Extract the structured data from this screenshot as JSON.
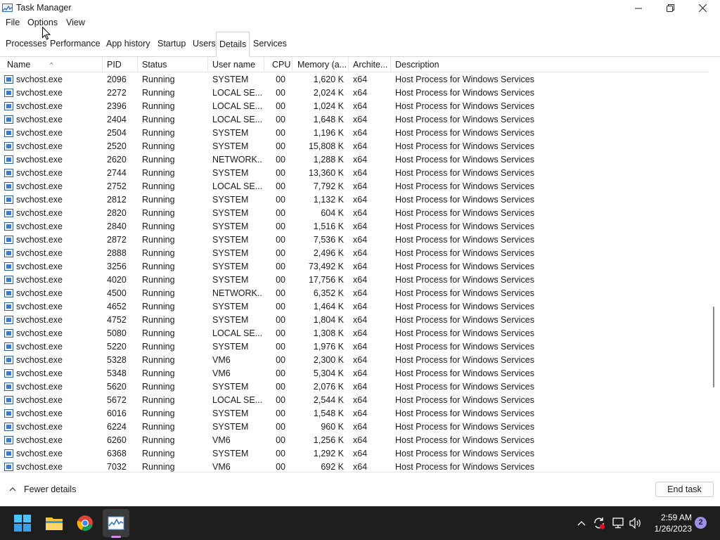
{
  "window": {
    "title": "Task Manager"
  },
  "menu": [
    "File",
    "Options",
    "View"
  ],
  "tabs": [
    {
      "label": "Processes",
      "active": false
    },
    {
      "label": "Performance",
      "active": false
    },
    {
      "label": "App history",
      "active": false
    },
    {
      "label": "Startup",
      "active": false
    },
    {
      "label": "Users",
      "active": false
    },
    {
      "label": "Details",
      "active": true
    },
    {
      "label": "Services",
      "active": false
    }
  ],
  "columns": {
    "name": "Name",
    "pid": "PID",
    "status": "Status",
    "user": "User name",
    "cpu": "CPU",
    "memory": "Memory (a...",
    "arch": "Archite...",
    "description": "Description"
  },
  "rows": [
    {
      "name": "svchost.exe",
      "pid": "2096",
      "status": "Running",
      "user": "SYSTEM",
      "cpu": "00",
      "memory": "1,620 K",
      "arch": "x64",
      "description": "Host Process for Windows Services"
    },
    {
      "name": "svchost.exe",
      "pid": "2272",
      "status": "Running",
      "user": "LOCAL SE...",
      "cpu": "00",
      "memory": "2,024 K",
      "arch": "x64",
      "description": "Host Process for Windows Services"
    },
    {
      "name": "svchost.exe",
      "pid": "2396",
      "status": "Running",
      "user": "LOCAL SE...",
      "cpu": "00",
      "memory": "1,024 K",
      "arch": "x64",
      "description": "Host Process for Windows Services"
    },
    {
      "name": "svchost.exe",
      "pid": "2404",
      "status": "Running",
      "user": "LOCAL SE...",
      "cpu": "00",
      "memory": "1,648 K",
      "arch": "x64",
      "description": "Host Process for Windows Services"
    },
    {
      "name": "svchost.exe",
      "pid": "2504",
      "status": "Running",
      "user": "SYSTEM",
      "cpu": "00",
      "memory": "1,196 K",
      "arch": "x64",
      "description": "Host Process for Windows Services"
    },
    {
      "name": "svchost.exe",
      "pid": "2520",
      "status": "Running",
      "user": "SYSTEM",
      "cpu": "00",
      "memory": "15,808 K",
      "arch": "x64",
      "description": "Host Process for Windows Services"
    },
    {
      "name": "svchost.exe",
      "pid": "2620",
      "status": "Running",
      "user": "NETWORK...",
      "cpu": "00",
      "memory": "1,288 K",
      "arch": "x64",
      "description": "Host Process for Windows Services"
    },
    {
      "name": "svchost.exe",
      "pid": "2744",
      "status": "Running",
      "user": "SYSTEM",
      "cpu": "00",
      "memory": "13,360 K",
      "arch": "x64",
      "description": "Host Process for Windows Services"
    },
    {
      "name": "svchost.exe",
      "pid": "2752",
      "status": "Running",
      "user": "LOCAL SE...",
      "cpu": "00",
      "memory": "7,792 K",
      "arch": "x64",
      "description": "Host Process for Windows Services"
    },
    {
      "name": "svchost.exe",
      "pid": "2812",
      "status": "Running",
      "user": "SYSTEM",
      "cpu": "00",
      "memory": "1,132 K",
      "arch": "x64",
      "description": "Host Process for Windows Services"
    },
    {
      "name": "svchost.exe",
      "pid": "2820",
      "status": "Running",
      "user": "SYSTEM",
      "cpu": "00",
      "memory": "604 K",
      "arch": "x64",
      "description": "Host Process for Windows Services"
    },
    {
      "name": "svchost.exe",
      "pid": "2840",
      "status": "Running",
      "user": "SYSTEM",
      "cpu": "00",
      "memory": "1,516 K",
      "arch": "x64",
      "description": "Host Process for Windows Services"
    },
    {
      "name": "svchost.exe",
      "pid": "2872",
      "status": "Running",
      "user": "SYSTEM",
      "cpu": "00",
      "memory": "7,536 K",
      "arch": "x64",
      "description": "Host Process for Windows Services"
    },
    {
      "name": "svchost.exe",
      "pid": "2888",
      "status": "Running",
      "user": "SYSTEM",
      "cpu": "00",
      "memory": "2,496 K",
      "arch": "x64",
      "description": "Host Process for Windows Services"
    },
    {
      "name": "svchost.exe",
      "pid": "3256",
      "status": "Running",
      "user": "SYSTEM",
      "cpu": "00",
      "memory": "73,492 K",
      "arch": "x64",
      "description": "Host Process for Windows Services"
    },
    {
      "name": "svchost.exe",
      "pid": "4020",
      "status": "Running",
      "user": "SYSTEM",
      "cpu": "00",
      "memory": "17,756 K",
      "arch": "x64",
      "description": "Host Process for Windows Services"
    },
    {
      "name": "svchost.exe",
      "pid": "4500",
      "status": "Running",
      "user": "NETWORK...",
      "cpu": "00",
      "memory": "6,352 K",
      "arch": "x64",
      "description": "Host Process for Windows Services"
    },
    {
      "name": "svchost.exe",
      "pid": "4652",
      "status": "Running",
      "user": "SYSTEM",
      "cpu": "00",
      "memory": "1,464 K",
      "arch": "x64",
      "description": "Host Process for Windows Services"
    },
    {
      "name": "svchost.exe",
      "pid": "4752",
      "status": "Running",
      "user": "SYSTEM",
      "cpu": "00",
      "memory": "1,804 K",
      "arch": "x64",
      "description": "Host Process for Windows Services"
    },
    {
      "name": "svchost.exe",
      "pid": "5080",
      "status": "Running",
      "user": "LOCAL SE...",
      "cpu": "00",
      "memory": "1,308 K",
      "arch": "x64",
      "description": "Host Process for Windows Services"
    },
    {
      "name": "svchost.exe",
      "pid": "5220",
      "status": "Running",
      "user": "SYSTEM",
      "cpu": "00",
      "memory": "1,976 K",
      "arch": "x64",
      "description": "Host Process for Windows Services"
    },
    {
      "name": "svchost.exe",
      "pid": "5328",
      "status": "Running",
      "user": "VM6",
      "cpu": "00",
      "memory": "2,300 K",
      "arch": "x64",
      "description": "Host Process for Windows Services"
    },
    {
      "name": "svchost.exe",
      "pid": "5348",
      "status": "Running",
      "user": "VM6",
      "cpu": "00",
      "memory": "5,304 K",
      "arch": "x64",
      "description": "Host Process for Windows Services"
    },
    {
      "name": "svchost.exe",
      "pid": "5620",
      "status": "Running",
      "user": "SYSTEM",
      "cpu": "00",
      "memory": "2,076 K",
      "arch": "x64",
      "description": "Host Process for Windows Services"
    },
    {
      "name": "svchost.exe",
      "pid": "5672",
      "status": "Running",
      "user": "LOCAL SE...",
      "cpu": "00",
      "memory": "2,544 K",
      "arch": "x64",
      "description": "Host Process for Windows Services"
    },
    {
      "name": "svchost.exe",
      "pid": "6016",
      "status": "Running",
      "user": "SYSTEM",
      "cpu": "00",
      "memory": "1,548 K",
      "arch": "x64",
      "description": "Host Process for Windows Services"
    },
    {
      "name": "svchost.exe",
      "pid": "6224",
      "status": "Running",
      "user": "SYSTEM",
      "cpu": "00",
      "memory": "960 K",
      "arch": "x64",
      "description": "Host Process for Windows Services"
    },
    {
      "name": "svchost.exe",
      "pid": "6260",
      "status": "Running",
      "user": "VM6",
      "cpu": "00",
      "memory": "1,256 K",
      "arch": "x64",
      "description": "Host Process for Windows Services"
    },
    {
      "name": "svchost.exe",
      "pid": "6368",
      "status": "Running",
      "user": "SYSTEM",
      "cpu": "00",
      "memory": "1,292 K",
      "arch": "x64",
      "description": "Host Process for Windows Services"
    },
    {
      "name": "svchost.exe",
      "pid": "7032",
      "status": "Running",
      "user": "VM6",
      "cpu": "00",
      "memory": "692 K",
      "arch": "x64",
      "description": "Host Process for Windows Services"
    }
  ],
  "footer": {
    "fewer_details": "Fewer details",
    "end_task": "End task"
  },
  "taskbar": {
    "time": "2:59 AM",
    "date": "1/26/2023",
    "notification_count": "2",
    "pinned": [
      "start-icon",
      "file-explorer-icon",
      "chrome-icon",
      "task-manager-icon"
    ]
  }
}
